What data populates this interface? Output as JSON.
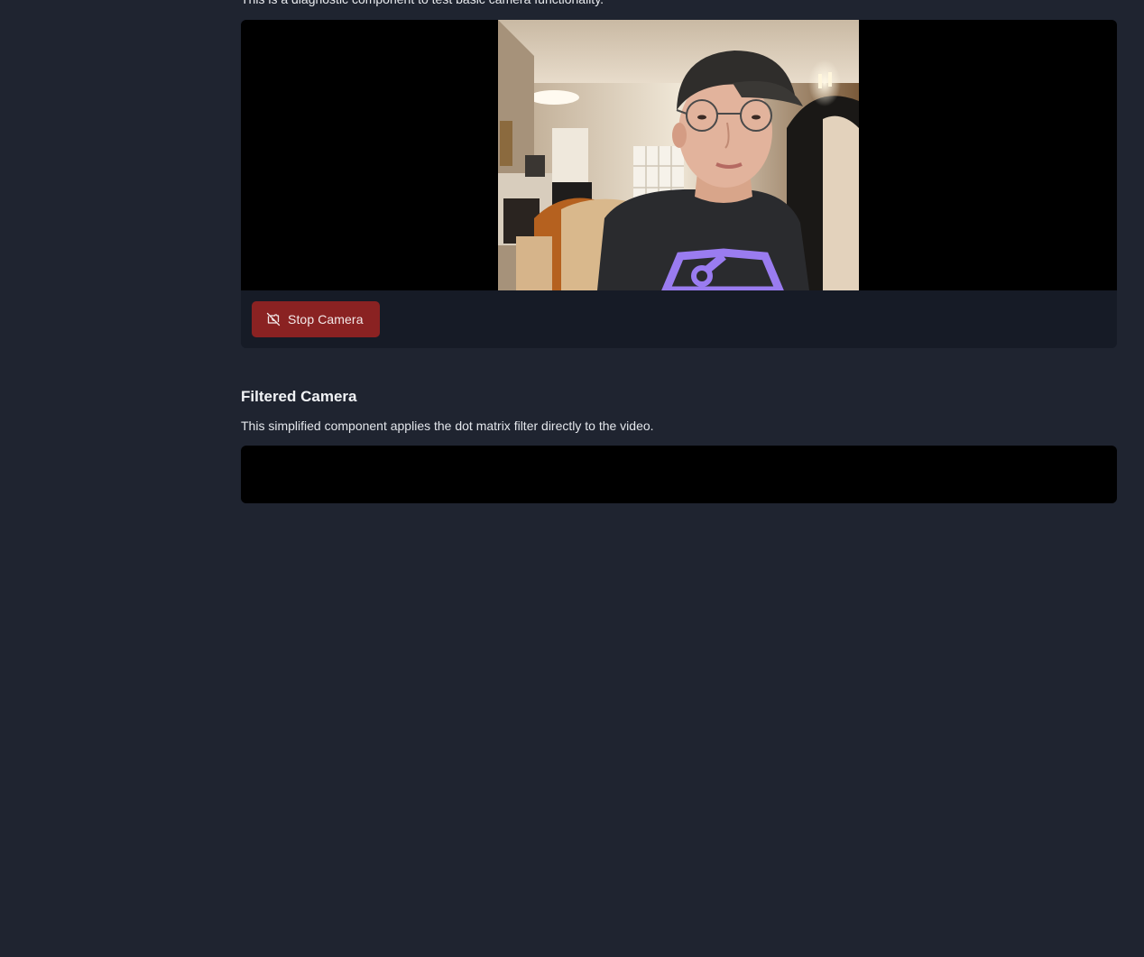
{
  "camera_test": {
    "description": "This is a diagnostic component to test basic camera functionality.",
    "stop_button": {
      "label": "Stop Camera",
      "icon": "camera-off-icon",
      "color": "#8a2222"
    }
  },
  "filtered_camera": {
    "title": "Filtered Camera",
    "description": "This simplified component applies the dot matrix filter directly to the video."
  },
  "theme": {
    "background": "#1f2430",
    "card_background": "#161b26",
    "video_background": "#000000",
    "accent_shirt_logo": "#9a7cf0"
  }
}
